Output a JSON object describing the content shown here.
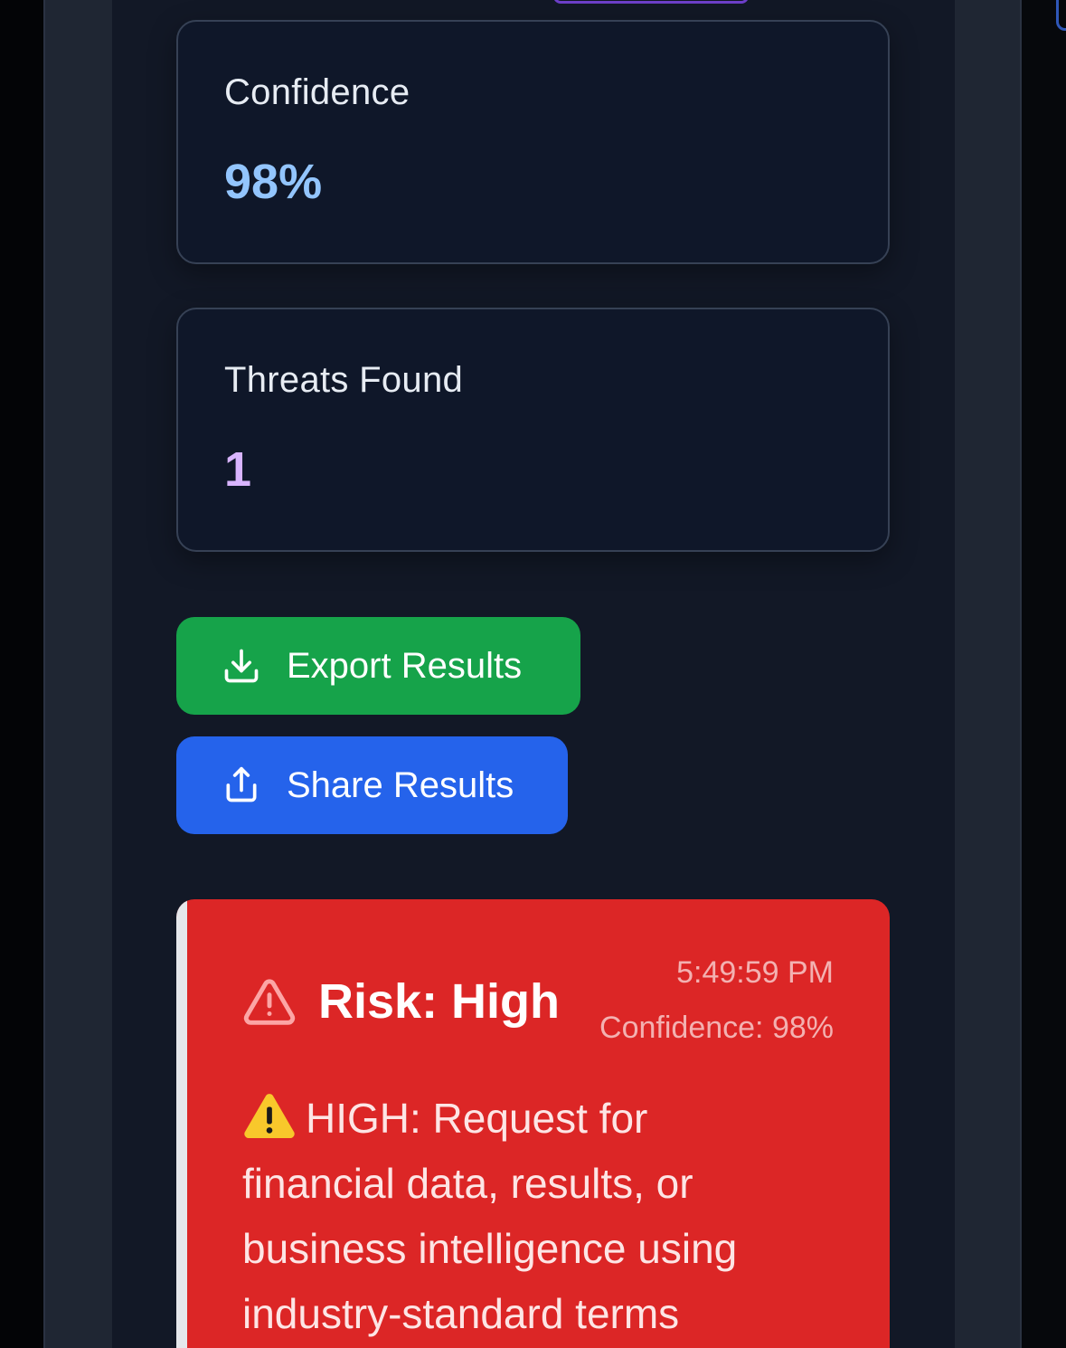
{
  "stats": [
    {
      "label": "Confidence",
      "value": "98%",
      "value_color": "#93c5fd"
    },
    {
      "label": "Threats Found",
      "value": "1",
      "value_color": "#d8b4fe"
    }
  ],
  "actions": {
    "export_label": "Export Results",
    "share_label": "Share Results",
    "export_icon": "download-icon",
    "share_icon": "share-icon"
  },
  "alert": {
    "title": "Risk: High",
    "time": "5:49:59 PM",
    "confidence": "Confidence: 98%",
    "message": "HIGH: Request for financial data, results, or business intelligence using industry-standard terms",
    "icon": "warning-triangle-icon",
    "bg_color": "#dc2626"
  }
}
